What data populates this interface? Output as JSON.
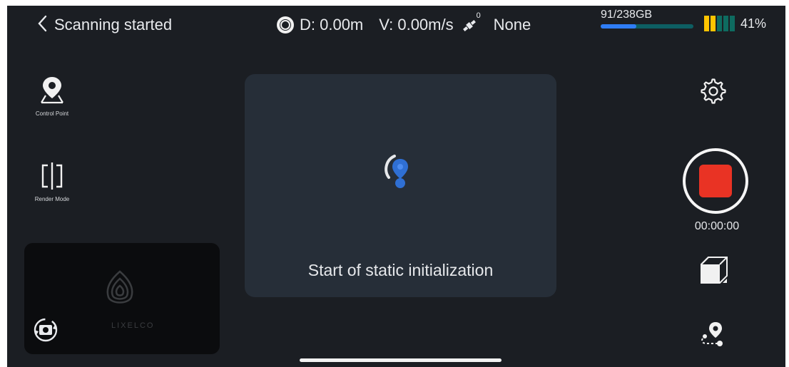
{
  "header": {
    "back_label": "Scanning started",
    "distance": "D: 0.00m",
    "velocity": "V: 0.00m/s",
    "satellite_count": "0",
    "fix_status": "None",
    "storage": {
      "label": "91/238GB",
      "used_fraction": 0.382
    },
    "battery": {
      "percent_label": "41%",
      "percent": 41
    }
  },
  "tools": {
    "control_point": "Control Point",
    "render_mode": "Render Mode"
  },
  "center": {
    "message": "Start of static initialization"
  },
  "preview": {
    "brand": "LIXELCO"
  },
  "recording": {
    "timer": "00:00:00"
  },
  "colors": {
    "record_red": "#e93324",
    "locate_blue": "#2f6fd3",
    "storage_fill": "#2f7df5",
    "battery_yellow": "#ffc400",
    "battery_teal": "#0e6b60"
  },
  "icons": {
    "back": "chevron-left-icon",
    "disc": "disc-icon",
    "satellite": "satellite-icon",
    "control_point": "location-pin-icon",
    "render_mode": "split-view-icon",
    "settings": "gear-icon",
    "cube": "cube-icon",
    "route": "route-pin-icon",
    "camera_switch": "camera-switch-icon"
  }
}
